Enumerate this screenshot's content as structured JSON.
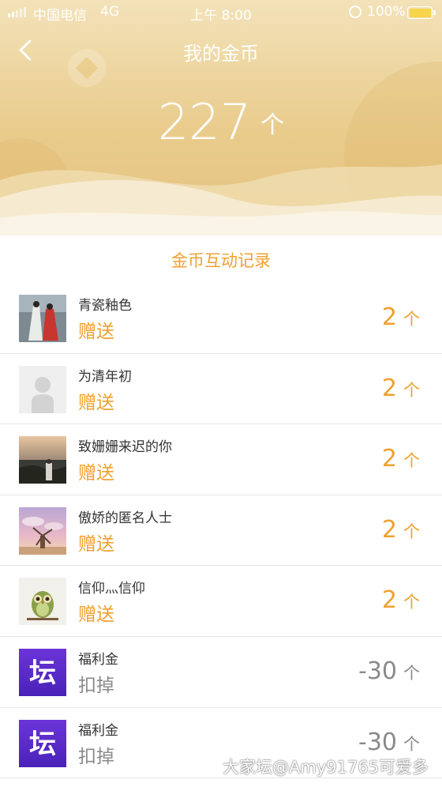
{
  "status_bar": {
    "carrier": "中国电信",
    "network": "4G",
    "time": "上午 8:00",
    "battery_percent": "100%"
  },
  "nav": {
    "title": "我的金币"
  },
  "balance": {
    "value": "227",
    "unit": "个"
  },
  "section_title": "金币互动记录",
  "colors": {
    "accent": "#f0a030",
    "header_gold": "#e9cc8d",
    "negative": "#8a8a8a",
    "forum_purple": "#5b2fd1"
  },
  "records": [
    {
      "name": "青瓷釉色",
      "action": "赠送",
      "amount": "2",
      "unit": "个",
      "avatar": "photo-figures-icon"
    },
    {
      "name": "为清年初",
      "action": "赠送",
      "amount": "2",
      "unit": "个",
      "avatar": "default-user-icon"
    },
    {
      "name": "致姗姗来迟的你",
      "action": "赠送",
      "amount": "2",
      "unit": "个",
      "avatar": "photo-sunset-icon"
    },
    {
      "name": "傲娇的匿名人士",
      "action": "赠送",
      "amount": "2",
      "unit": "个",
      "avatar": "photo-windmill-icon"
    },
    {
      "name": "信仰灬信仰",
      "action": "赠送",
      "amount": "2",
      "unit": "个",
      "avatar": "owl-icon"
    },
    {
      "name": "福利金",
      "action": "扣掉",
      "amount": "-30",
      "unit": "个",
      "avatar_text": "坛"
    },
    {
      "name": "福利金",
      "action": "扣掉",
      "amount": "-30",
      "unit": "个",
      "avatar_text": "坛"
    }
  ],
  "watermark": "大家坛@Amy91765可爱多"
}
